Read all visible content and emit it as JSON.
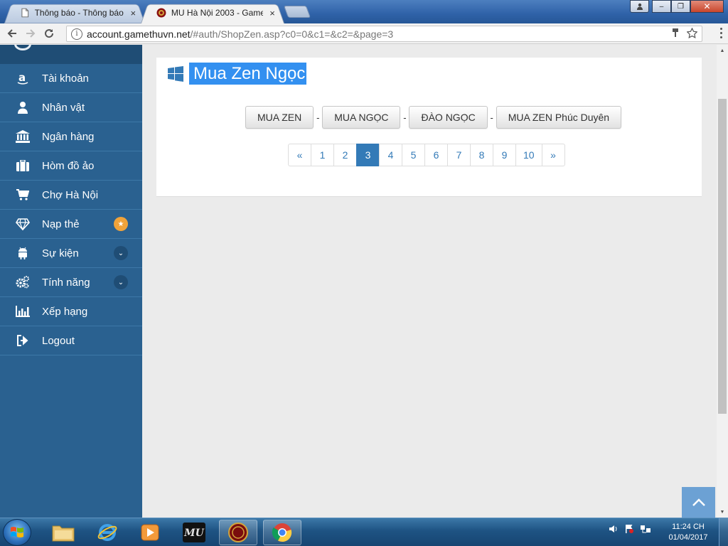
{
  "browser": {
    "tabs": [
      {
        "label": "Thông báo - Thông báo",
        "active": false,
        "close": "×"
      },
      {
        "label": "MU Hà Nội 2003 - Game",
        "active": true,
        "close": "×"
      }
    ],
    "address": {
      "host": "account.gamethuvn.net",
      "path": "/#auth/ShopZen.asp?c0=0&c1=&c2=&page=3"
    },
    "window_buttons": {
      "minimize": "‒",
      "maximize": "❐",
      "close": "✕"
    }
  },
  "sidebar": {
    "items": [
      {
        "label": "Tài khoản",
        "icon": "amazon-icon"
      },
      {
        "label": "Nhân vật",
        "icon": "user-icon"
      },
      {
        "label": "Ngân hàng",
        "icon": "bank-icon"
      },
      {
        "label": "Hòm đồ ảo",
        "icon": "briefcase-icon"
      },
      {
        "label": "Chợ Hà Nội",
        "icon": "cart-icon"
      },
      {
        "label": "Nạp thẻ",
        "icon": "diamond-icon",
        "badge": "★"
      },
      {
        "label": "Sự kiện",
        "icon": "android-icon",
        "badge": "⌄"
      },
      {
        "label": "Tính năng",
        "icon": "cogs-icon",
        "badge": "⌄"
      },
      {
        "label": "Xếp hạng",
        "icon": "bar-chart-icon"
      },
      {
        "label": "Logout",
        "icon": "sign-out-icon"
      }
    ]
  },
  "main": {
    "title": "Mua Zen Ngọc",
    "buttons": [
      "MUA ZEN",
      "MUA NGỌC",
      "ĐÀO NGỌC",
      "MUA ZEN Phúc Duyên"
    ],
    "separator": "-",
    "pagination": {
      "prev": "«",
      "pages": [
        "1",
        "2",
        "3",
        "4",
        "5",
        "6",
        "7",
        "8",
        "9",
        "10"
      ],
      "current": "3",
      "next": "»"
    }
  },
  "taskbar": {
    "clock_time": "11:24 CH",
    "clock_date": "01/04/2017",
    "mu_label": "MU"
  },
  "colors": {
    "sidebar_bg": "#2a6190",
    "accent": "#337ab7",
    "title_highlight": "#3390f0",
    "badge_orange": "#f0a33a"
  }
}
